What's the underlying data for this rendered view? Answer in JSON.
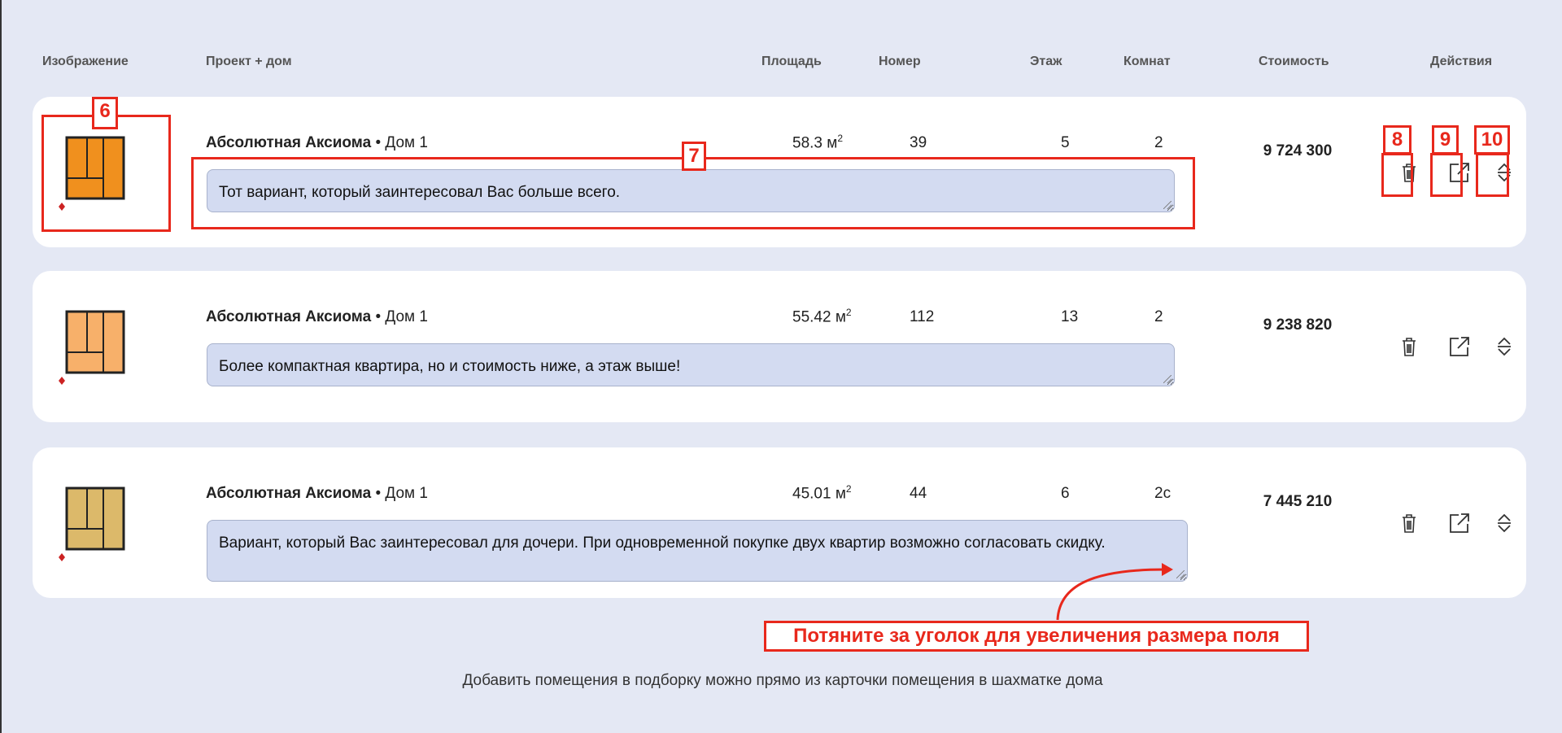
{
  "headers": {
    "image": "Изображение",
    "project": "Проект + дом",
    "area": "Площадь",
    "number": "Номер",
    "floor": "Этаж",
    "rooms": "Комнат",
    "price": "Стоимость",
    "actions": "Действия"
  },
  "rows": [
    {
      "project": "Абсолютная Аксиома",
      "house": "• Дом 1",
      "area": "58.3 м",
      "area_sup": "2",
      "number": "39",
      "floor": "5",
      "rooms": "2",
      "comment": "Тот вариант, который заинтересовал Вас больше всего.",
      "price": "9 724 300",
      "plan_color": "#f0901e"
    },
    {
      "project": "Абсолютная Аксиома",
      "house": "• Дом 1",
      "area": "55.42 м",
      "area_sup": "2",
      "number": "112",
      "floor": "13",
      "rooms": "2",
      "comment": "Более компактная квартира, но и стоимость ниже, а этаж выше!",
      "price": "9 238 820",
      "plan_color": "#f7b06a"
    },
    {
      "project": "Абсолютная Аксиома",
      "house": "• Дом 1",
      "area": "45.01 м",
      "area_sup": "2",
      "number": "44",
      "floor": "6",
      "rooms": "2с",
      "comment": "Вариант, который Вас заинтересовал для дочери. При одновременной покупке двух квартир возможно согласовать скидку.",
      "price": "7 445 210",
      "plan_color": "#dcb96a"
    }
  ],
  "annotations": {
    "l6": "6",
    "l7": "7",
    "l8": "8",
    "l9": "9",
    "l10": "10",
    "hint": "Потяните за уголок для увеличения размера поля"
  },
  "footer": "Добавить помещения в подборку можно прямо из карточки помещения в шахматке дома",
  "colors": {
    "annotation": "#e8281c",
    "background": "#e4e8f4",
    "textarea": "#d3dbf1"
  }
}
